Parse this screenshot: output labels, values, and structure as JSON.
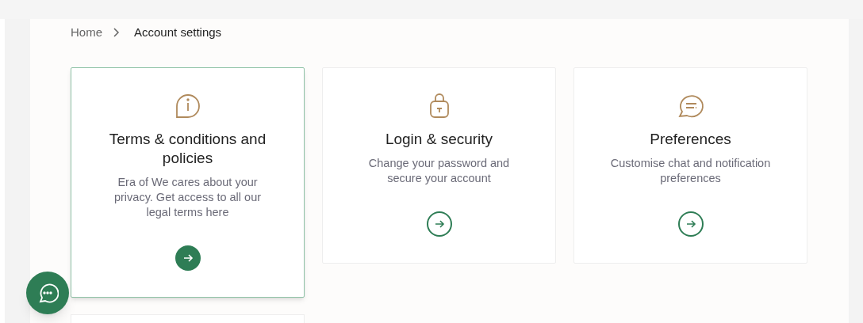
{
  "breadcrumb": [
    {
      "label": "Home",
      "current": false
    },
    {
      "label": "Account settings",
      "current": true
    }
  ],
  "cards": [
    {
      "title": "Terms & conditions and policies",
      "description": "Era of We cares about your privacy. Get access to all our legal terms here",
      "selected": true
    },
    {
      "title": "Login & security",
      "description": "Change your password and secure your account",
      "selected": false
    },
    {
      "title": "Preferences",
      "description": "Customise chat and notification preferences",
      "selected": false
    }
  ]
}
